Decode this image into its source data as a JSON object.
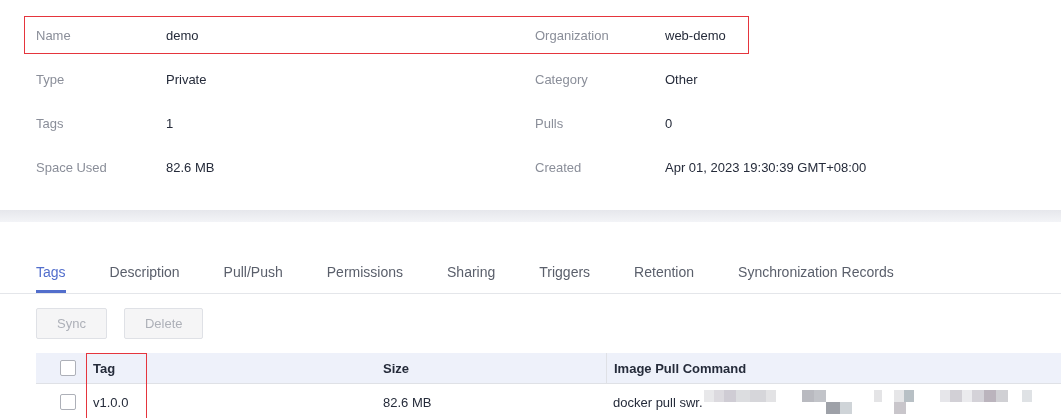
{
  "details": [
    {
      "label": "Name",
      "value": "demo"
    },
    {
      "label": "Organization",
      "value": "web-demo"
    },
    {
      "label": "Type",
      "value": "Private"
    },
    {
      "label": "Category",
      "value": "Other"
    },
    {
      "label": "Tags",
      "value": "1"
    },
    {
      "label": "Pulls",
      "value": "0"
    },
    {
      "label": "Space Used",
      "value": "82.6 MB"
    },
    {
      "label": "Created",
      "value": "Apr 01, 2023 19:30:39 GMT+08:00"
    }
  ],
  "tabs": [
    {
      "label": "Tags",
      "selected": true
    },
    {
      "label": "Description",
      "selected": false
    },
    {
      "label": "Pull/Push",
      "selected": false
    },
    {
      "label": "Permissions",
      "selected": false
    },
    {
      "label": "Sharing",
      "selected": false
    },
    {
      "label": "Triggers",
      "selected": false
    },
    {
      "label": "Retention",
      "selected": false
    },
    {
      "label": "Synchronization Records",
      "selected": false
    }
  ],
  "buttons": [
    {
      "label": "Sync",
      "disabled": true
    },
    {
      "label": "Delete",
      "disabled": true
    }
  ],
  "table": {
    "select_all_checked": false,
    "columns": [
      "Tag",
      "Size",
      "Image Pull Command"
    ],
    "rows": [
      {
        "checked": false,
        "cells": [
          "v1.0.0",
          "82.6 MB",
          "docker pull swr."
        ]
      }
    ]
  }
}
